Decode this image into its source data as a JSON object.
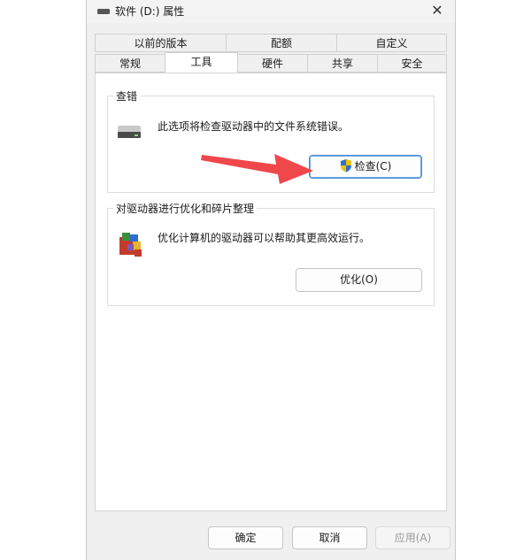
{
  "window": {
    "title": "软件 (D:) 属性"
  },
  "tabs_row1": [
    {
      "label": "以前的版本"
    },
    {
      "label": "配额"
    },
    {
      "label": "自定义"
    }
  ],
  "tabs_row2": [
    {
      "label": "常规"
    },
    {
      "label": "工具"
    },
    {
      "label": "硬件"
    },
    {
      "label": "共享"
    },
    {
      "label": "安全"
    }
  ],
  "check_group": {
    "title": "查错",
    "description": "此选项将检查驱动器中的文件系统错误。",
    "button_label": "检查(C)"
  },
  "optimize_group": {
    "title": "对驱动器进行优化和碎片整理",
    "description": "优化计算机的驱动器可以帮助其更高效运行。",
    "button_label": "优化(O)"
  },
  "footer": {
    "ok_label": "确定",
    "cancel_label": "取消",
    "apply_label": "应用(A)"
  },
  "colors": {
    "accent": "#0067c0",
    "annotation_arrow": "#f0474b"
  }
}
